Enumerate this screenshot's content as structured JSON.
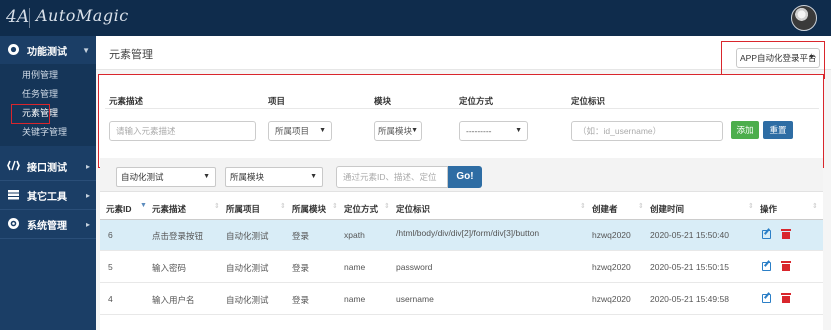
{
  "app": {
    "name": "AutoMagic",
    "logo_glyph": "4A"
  },
  "sidebar": {
    "groups": [
      {
        "label": "功能测试",
        "icon": "dashboard-icon",
        "open": true,
        "items": [
          "用例管理",
          "任务管理",
          "元素管理",
          "关键字管理"
        ],
        "active": "元素管理"
      },
      {
        "label": "接口测试",
        "icon": "api-icon"
      },
      {
        "label": "其它工具",
        "icon": "tools-icon"
      },
      {
        "label": "系统管理",
        "icon": "settings-icon"
      }
    ]
  },
  "page": {
    "title": "元素管理",
    "platform_select": "APP自动化登录平台"
  },
  "search": {
    "labels": {
      "desc": "元素描述",
      "project": "项目",
      "module": "模块",
      "method": "定位方式",
      "locator": "定位标识"
    },
    "desc_placeholder": "请输入元素描述",
    "project_value": "所属项目",
    "module_value": "所属模块",
    "method_value": "---------",
    "locator_placeholder": "（如：id_username）",
    "add_label": "添加",
    "reset_label": "重置"
  },
  "filter": {
    "project": "自动化测试",
    "module": "所属模块",
    "search_placeholder": "通过元素ID、描述、定位",
    "go_label": "Go!"
  },
  "table": {
    "headers": [
      "元素ID",
      "元素描述",
      "所属项目",
      "所属模块",
      "定位方式",
      "定位标识",
      "创建者",
      "创建时间",
      "操作"
    ],
    "rows": [
      [
        "6",
        "点击登录按钮",
        "自动化测试",
        "登录",
        "xpath",
        "/html/body/div/div[2]/form/div[3]/button",
        "hzwq2020",
        "2020-05-21 15:50:40"
      ],
      [
        "5",
        "输入密码",
        "自动化测试",
        "登录",
        "name",
        "password",
        "hzwq2020",
        "2020-05-21 15:50:15"
      ],
      [
        "4",
        "输入用户名",
        "自动化测试",
        "登录",
        "name",
        "username",
        "hzwq2020",
        "2020-05-21 15:49:58"
      ]
    ]
  },
  "colors": {
    "topbar": "#0f2c4c",
    "sidebar": "#1b3e66",
    "highlight": "#d9262c",
    "primary": "#2e6da4",
    "success": "#4cae4c",
    "row_selected": "#d9edf7"
  }
}
